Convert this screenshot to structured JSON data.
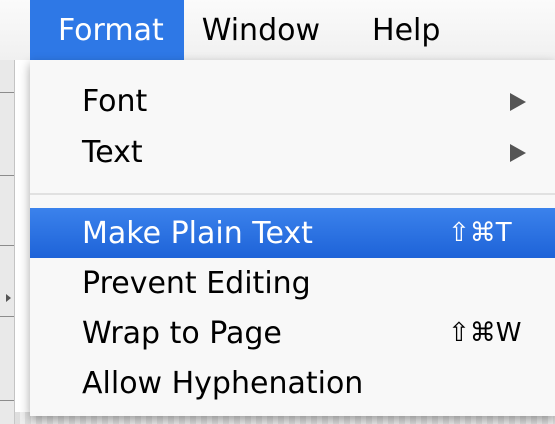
{
  "menubar": {
    "items": [
      {
        "label": "Format"
      },
      {
        "label": "Window"
      },
      {
        "label": "Help"
      }
    ]
  },
  "menu": {
    "items": [
      {
        "label": "Font",
        "submenu_icon": "chevron-right-icon"
      },
      {
        "label": "Text",
        "submenu_icon": "chevron-right-icon"
      },
      {
        "label": "Make Plain Text",
        "shortcut": "⇧⌘T",
        "highlighted": true
      },
      {
        "label": "Prevent Editing"
      },
      {
        "label": "Wrap to Page",
        "shortcut": "⇧⌘W"
      },
      {
        "label": "Allow Hyphenation"
      }
    ]
  },
  "colors": {
    "highlight": "#2e78e6",
    "menu_background": "#f8f8f8"
  }
}
